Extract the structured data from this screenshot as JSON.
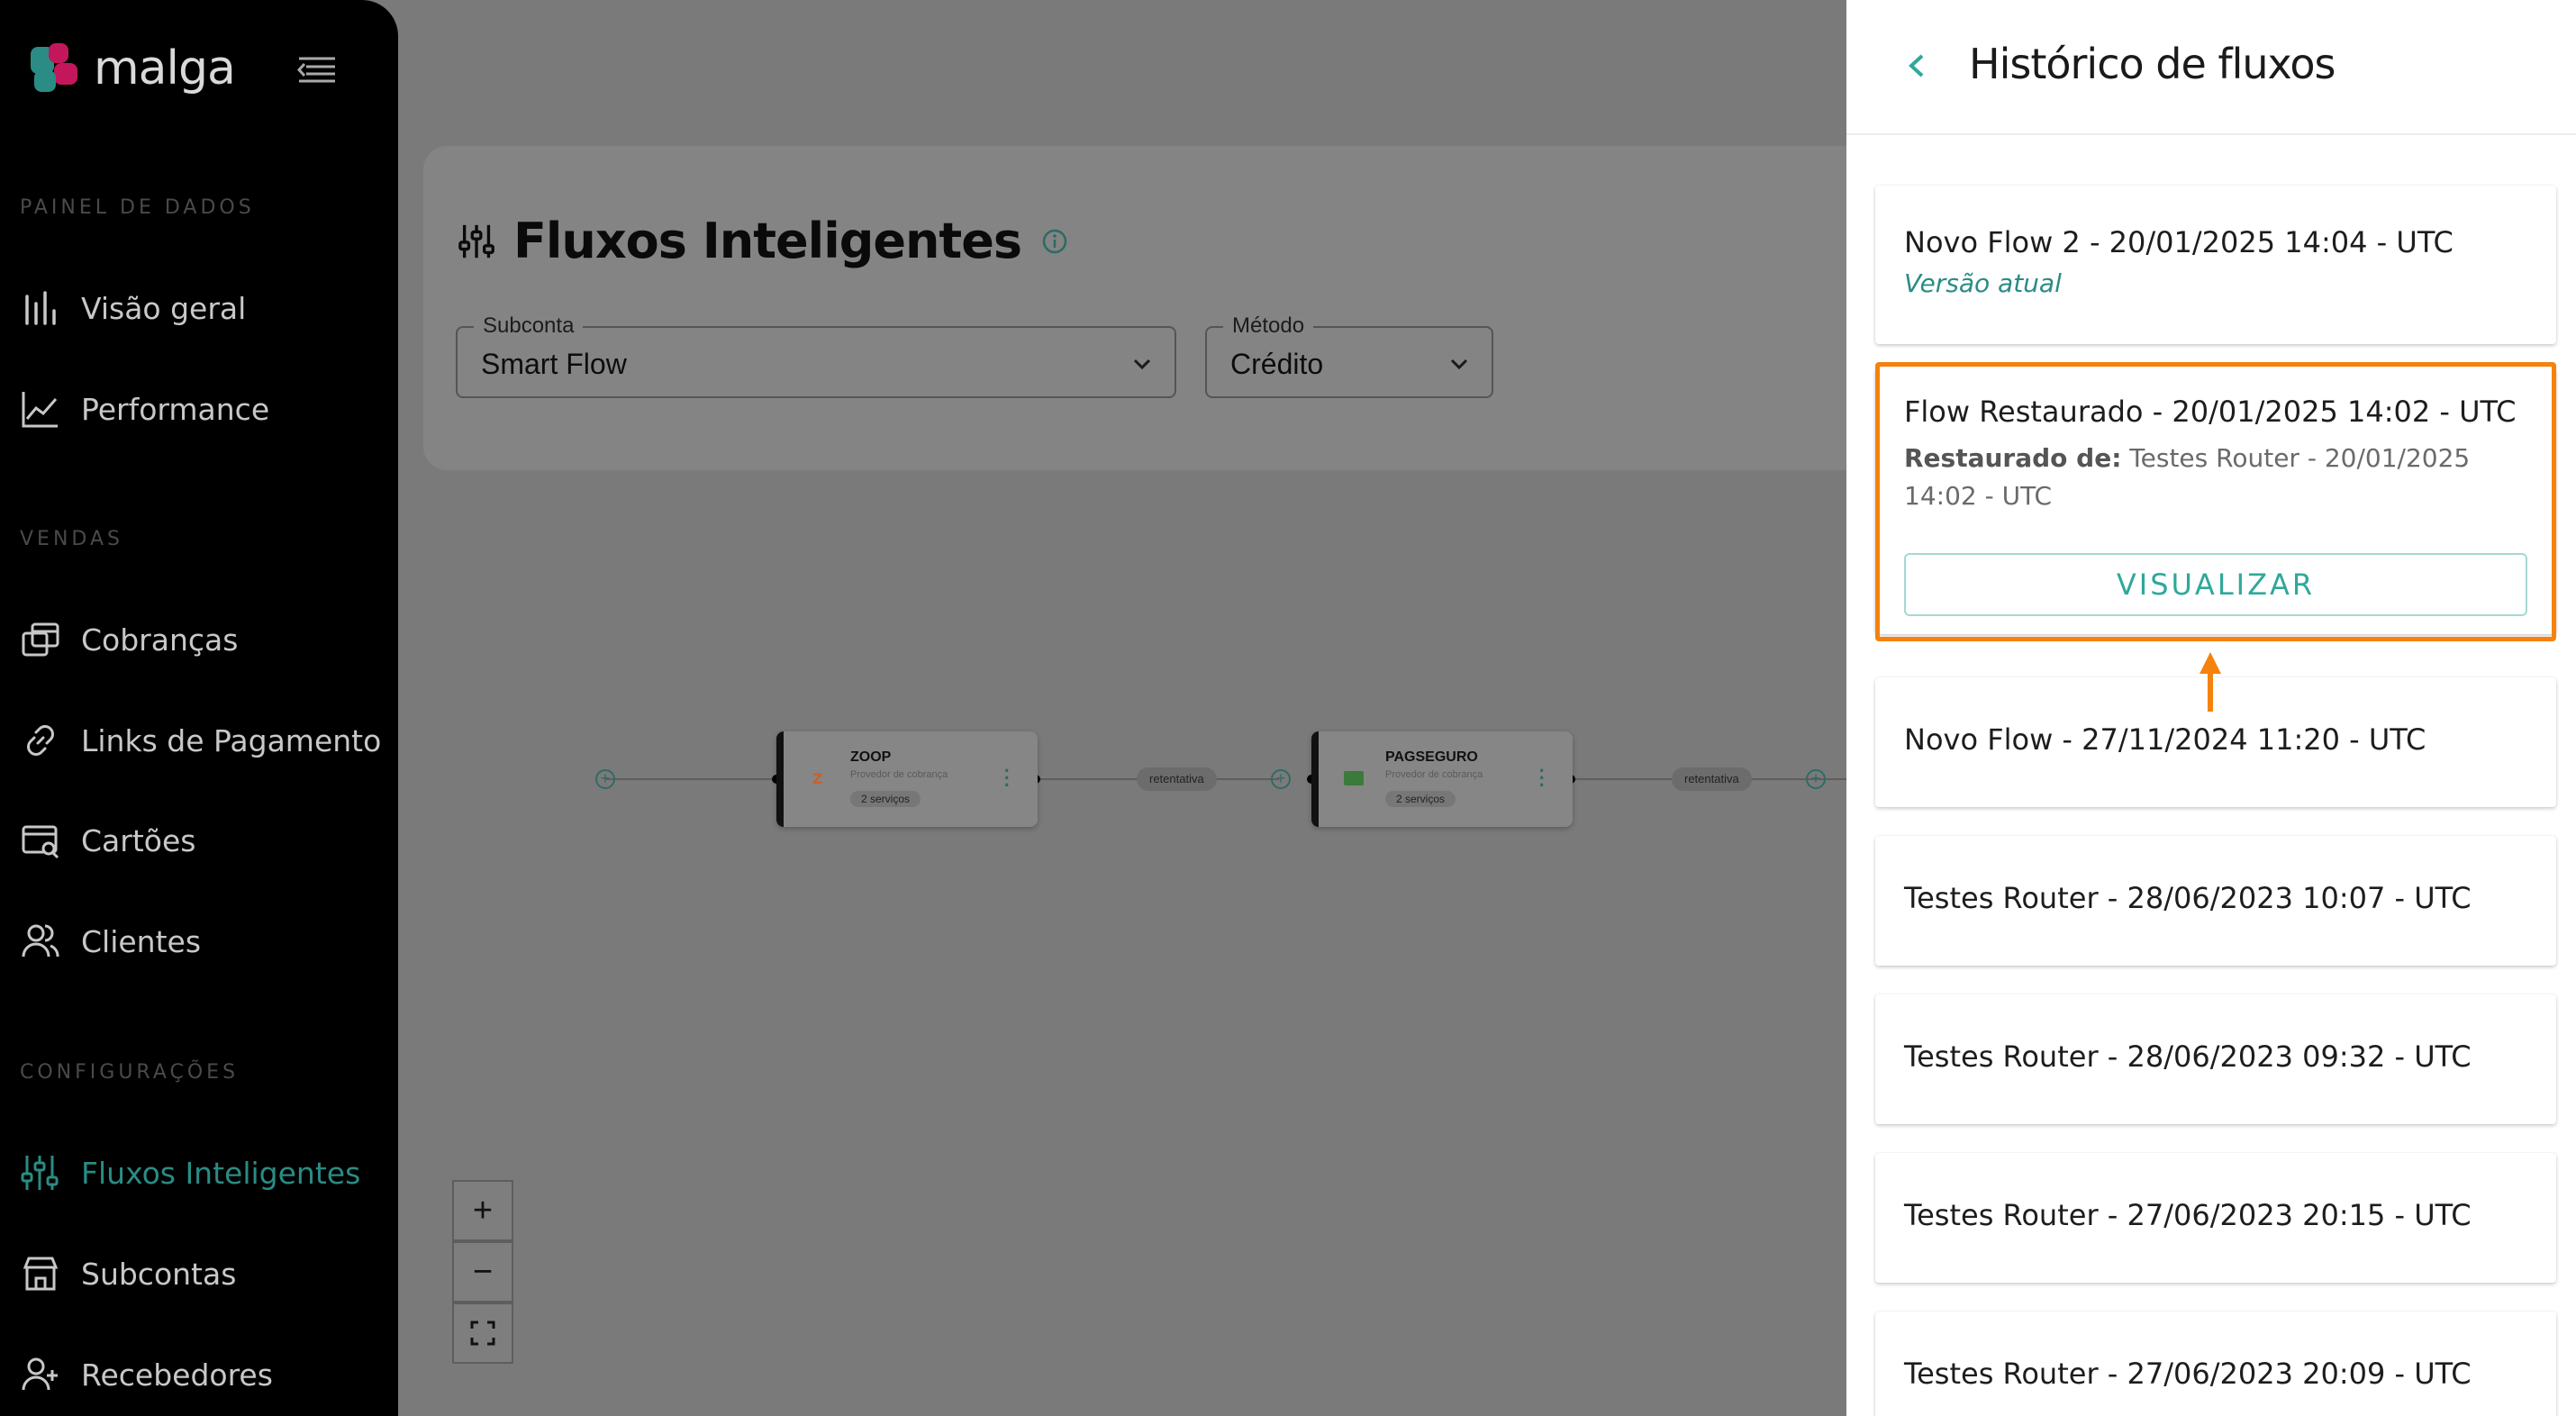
{
  "app": {
    "logo_text": "malga",
    "accent_color": "#2a8c84",
    "highlight_color": "#f5820d"
  },
  "sidebar": {
    "sections": [
      {
        "title": "PAINEL DE DADOS"
      },
      {
        "title": "VENDAS"
      },
      {
        "title": "CONFIGURAÇÕES"
      }
    ],
    "items": [
      {
        "label": "Visão geral",
        "icon": "bar-chart-icon"
      },
      {
        "label": "Performance",
        "icon": "line-chart-icon"
      },
      {
        "label": "Cobranças",
        "icon": "charges-icon"
      },
      {
        "label": "Links de Pagamento",
        "icon": "link-icon"
      },
      {
        "label": "Cartões",
        "icon": "card-search-icon"
      },
      {
        "label": "Clientes",
        "icon": "users-icon"
      },
      {
        "label": "Fluxos Inteligentes",
        "icon": "sliders-icon",
        "active": true
      },
      {
        "label": "Subcontas",
        "icon": "store-icon"
      },
      {
        "label": "Recebedores",
        "icon": "user-plus-icon"
      }
    ]
  },
  "main": {
    "title": "Fluxos Inteligentes",
    "filters": {
      "subconta": {
        "label": "Subconta",
        "value": "Smart Flow"
      },
      "metodo": {
        "label": "Método",
        "value": "Crédito"
      }
    },
    "flow": {
      "nodes": [
        {
          "title": "ZOOP",
          "subtitle": "Provedor de cobrança",
          "badge": "2 serviços"
        },
        {
          "title": "PAGSEGURO",
          "subtitle": "Provedor de cobrança",
          "badge": "2 serviços"
        }
      ],
      "connector_label": "retentativa"
    },
    "zoom": {
      "in": "+",
      "out": "−"
    }
  },
  "panel": {
    "title": "Histórico de fluxos",
    "entries": [
      {
        "title": "Novo Flow 2 - 20/01/2025 14:04 - UTC",
        "subtitle": "Versão atual"
      },
      {
        "title": "Flow Restaurado - 20/01/2025 14:02 - UTC",
        "restored_label": "Restaurado de:",
        "restored_value": "Testes Router - 20/01/2025 14:02 - UTC",
        "button": "VISUALIZAR"
      },
      {
        "title": "Novo Flow - 27/11/2024 11:20 - UTC"
      },
      {
        "title": "Testes Router - 28/06/2023 10:07 - UTC"
      },
      {
        "title": "Testes Router - 28/06/2023 09:32 - UTC"
      },
      {
        "title": "Testes Router - 27/06/2023 20:15 - UTC"
      },
      {
        "title": "Testes Router - 27/06/2023 20:09 - UTC"
      }
    ]
  }
}
